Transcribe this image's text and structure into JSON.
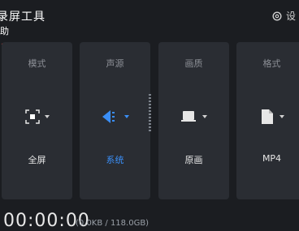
{
  "app": {
    "title": "录屏工具",
    "subtitle": "助"
  },
  "header": {
    "settings_label": "设"
  },
  "cards": [
    {
      "label": "模式",
      "value": "全屏",
      "icon": "fullscreen-icon"
    },
    {
      "label": "声源",
      "value": "系统",
      "icon": "speaker-icon"
    },
    {
      "label": "画质",
      "value": "原画",
      "icon": "monitor-icon"
    },
    {
      "label": "格式",
      "value": "MP4",
      "icon": "file-icon"
    }
  ],
  "status": {
    "timer": "00:00:00",
    "size": "(0.0KB / 118.0GB)"
  },
  "colors": {
    "accent": "#3a8ef6",
    "background": "#1b1d21",
    "card": "#2a2d33",
    "annotation": "#e0443a"
  }
}
